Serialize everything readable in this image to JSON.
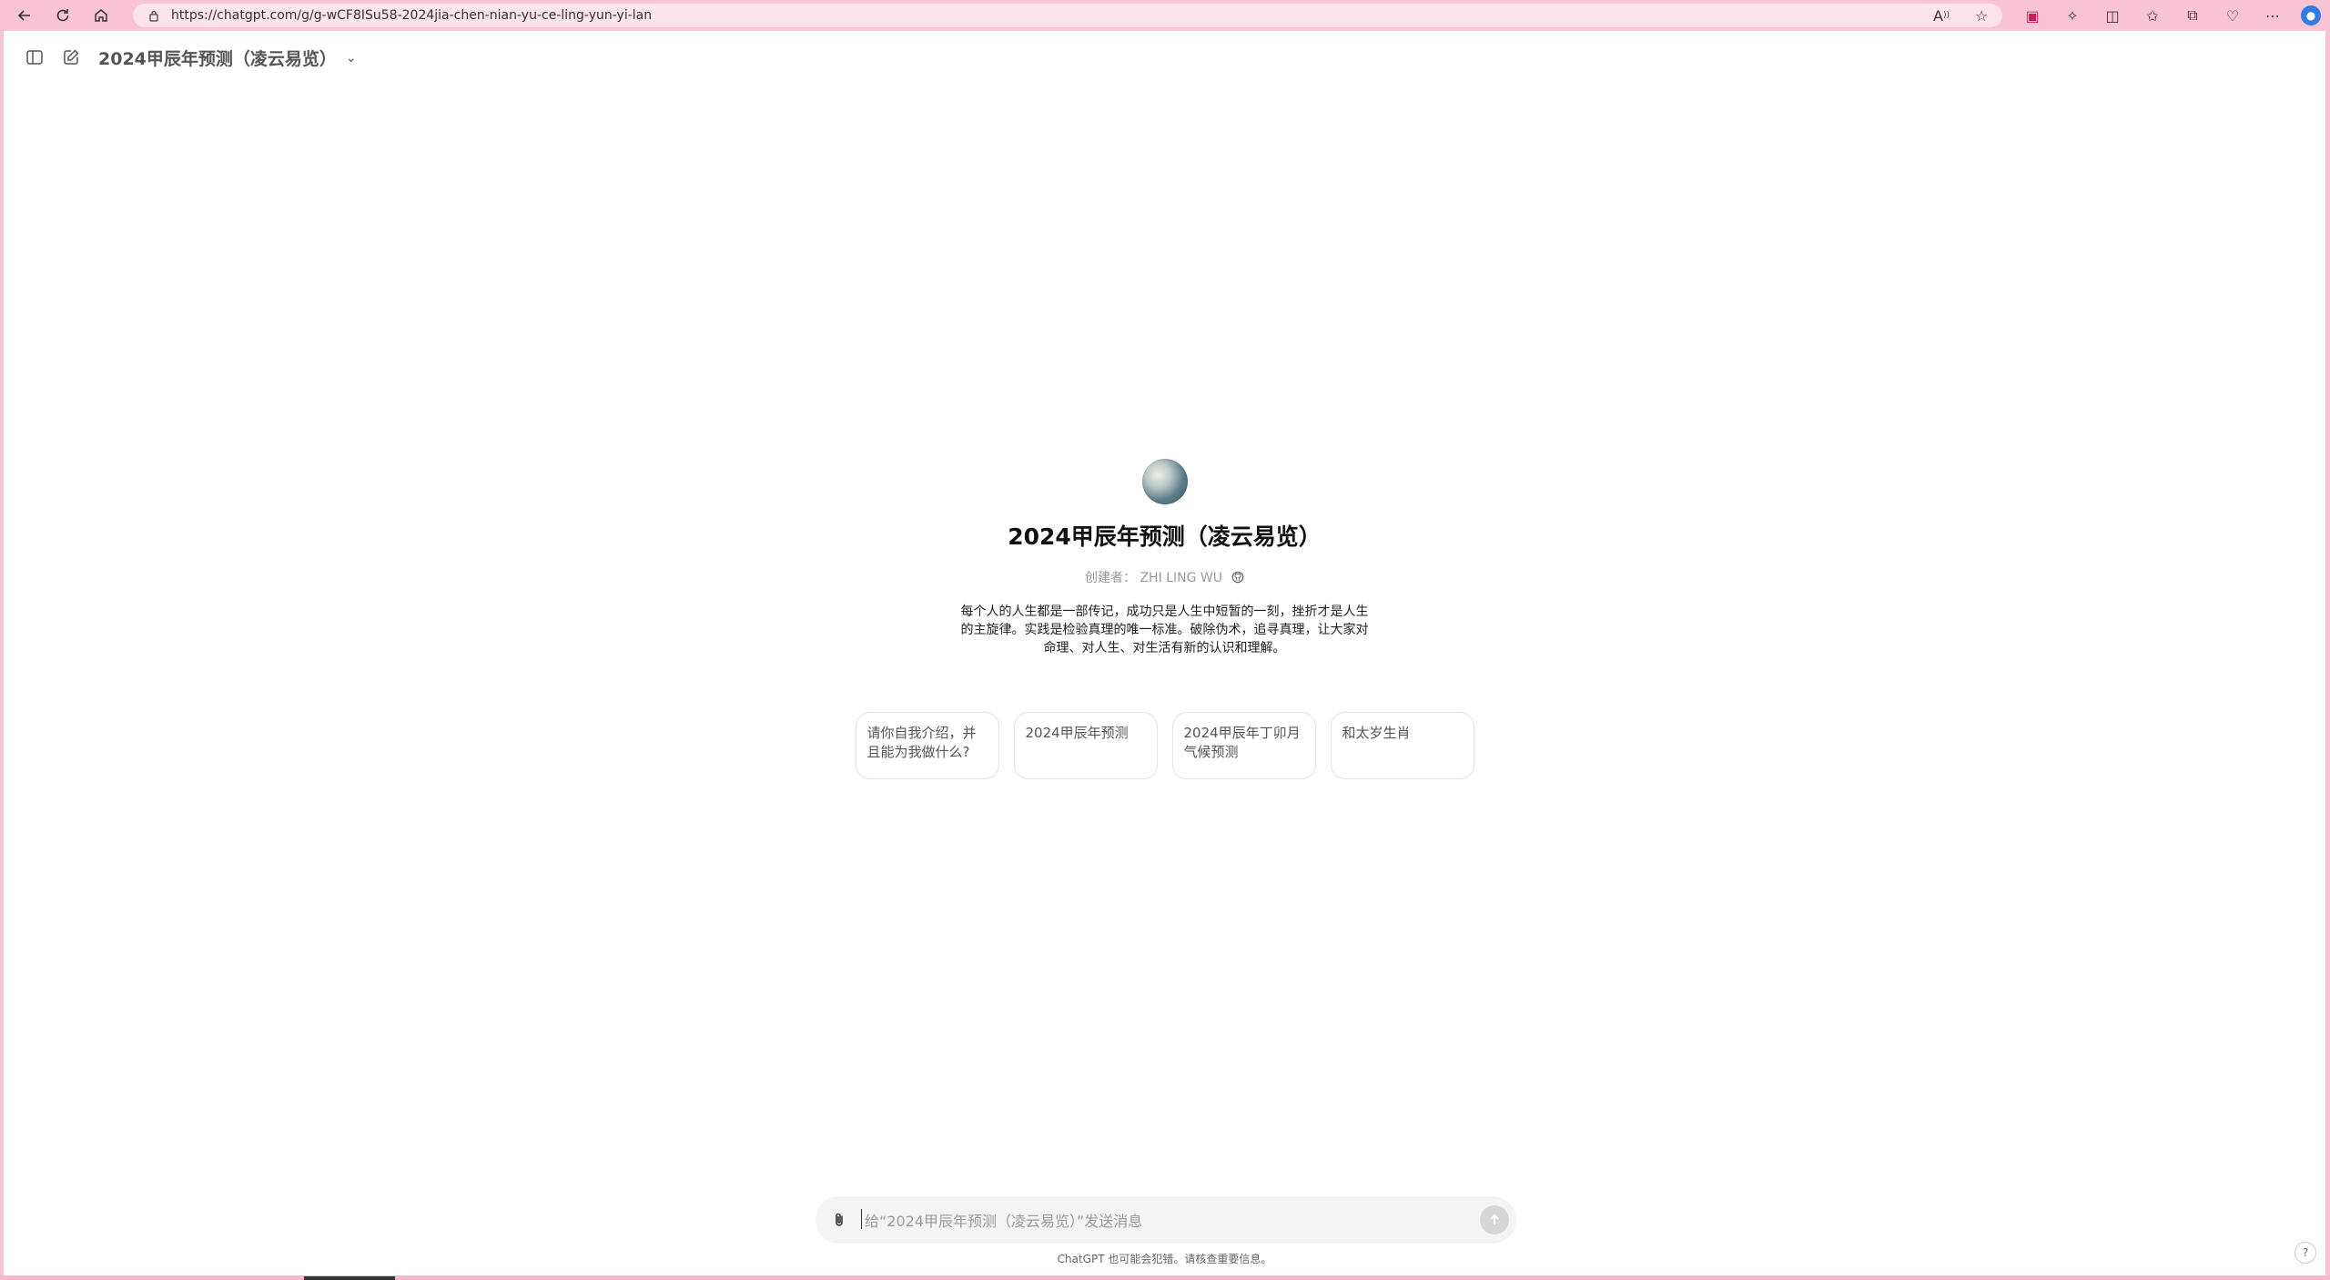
{
  "browser": {
    "url": "https://chatgpt.com/g/g-wCF8ISu58-2024jia-chen-nian-yu-ce-ling-yun-yi-lan"
  },
  "header": {
    "gpt_name": "2024甲辰年预测（凌云易览）"
  },
  "hero": {
    "title": "2024甲辰年预测（凌云易览）",
    "creator_prefix": "创建者：",
    "creator_name": "ZHI LING WU",
    "description": "每个人的人生都是一部传记，成功只是人生中短暂的一刻，挫折才是人生的主旋律。实践是检验真理的唯一标准。破除伪术，追寻真理，让大家对命理、对人生、对生活有新的认识和理解。"
  },
  "starters": [
    {
      "label": "请你自我介绍，并且能为我做什么?"
    },
    {
      "label": "2024甲辰年预测"
    },
    {
      "label": "2024甲辰年丁卯月气候预测"
    },
    {
      "label": "和太岁生肖"
    }
  ],
  "composer": {
    "placeholder": "给“2024甲辰年预测（凌云易览）”发送消息"
  },
  "footer": {
    "disclaimer": "ChatGPT 也可能会犯错。请核查重要信息。",
    "help": "?"
  },
  "colors": {
    "browser_frame": "#f9c3d6",
    "address_bar": "#fde3ec",
    "composer_bg": "#f4f4f4",
    "send_disabled": "#d7d7d7"
  }
}
